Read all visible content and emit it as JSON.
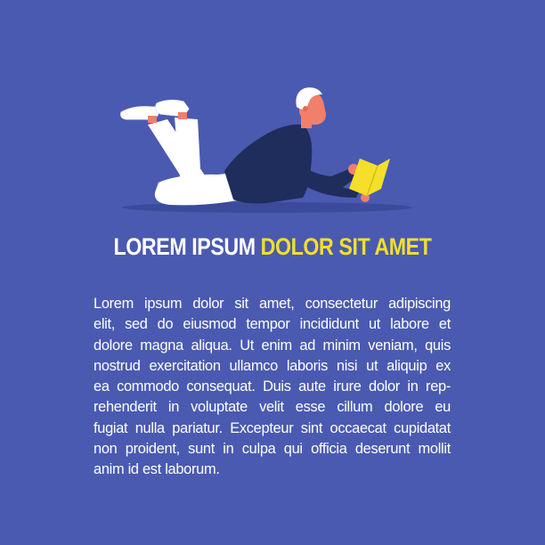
{
  "heading": {
    "part_white": "LOREM IPSUM",
    "part_yellow": "DOLOR SIT AMET"
  },
  "body": {
    "lines": [
      "Lorem ipsum dolor sit amet, consectetur adipiscing",
      "elit, sed do eiusmod tempor incididunt ut labore et",
      "dolore magna aliqua. Ut enim ad minim veniam, quis",
      "nostrud exercitation ullamco laboris nisi ut aliquip ex",
      "ea commodo consequat. Duis aute irure dolor in rep-",
      "rehenderit in voluptate velit esse cillum dolore eu",
      "fugiat nulla pariatur. Excepteur sint occaecat cupidatat",
      "non proident, sunt in culpa qui officia deserunt mollit",
      "anim id est laborum."
    ]
  },
  "colors": {
    "background": "#4a5ab1",
    "accent_yellow": "#f5df2b",
    "text": "#ffffff"
  }
}
